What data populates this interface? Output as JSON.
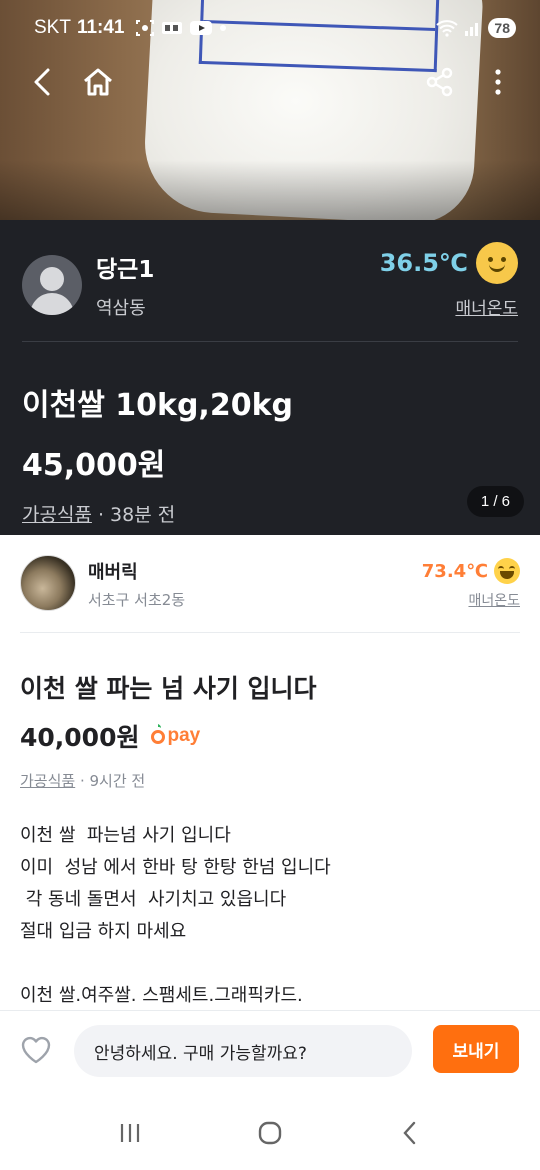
{
  "status_bar": {
    "carrier": "SKT",
    "time": "11:41",
    "battery": "78",
    "icons": [
      "screen-record-icon",
      "notification-icon",
      "youtube-icon",
      "dot-icon",
      "wifi-icon",
      "signal-icon"
    ]
  },
  "app_bar": {
    "icons": [
      "back-icon",
      "home-icon",
      "share-icon",
      "more-icon"
    ]
  },
  "screenshot_card": {
    "seller_name": "당근1",
    "seller_location": "역삼동",
    "manner_temp": "36.5℃",
    "manner_label": "매너온도",
    "title": "이천쌀 10kg,20kg",
    "price": "45,000원",
    "category": "가공식품",
    "meta_sep": " · ",
    "time_ago": "38분 전",
    "image_pager": "1 / 6"
  },
  "seller": {
    "name": "매버릭",
    "location": "서초구 서초2동",
    "manner_temp": "73.4℃",
    "manner_label": "매너온도"
  },
  "post": {
    "title": "이천 쌀 파는 넘 사기 입니다",
    "price": "40,000원",
    "pay_label": "pay",
    "category": "가공식품",
    "meta_sep": " · ",
    "time_ago": "9시간 전",
    "body": "이천 쌀  파는넘 사기 입니다\n이미  성남 에서 한바 탕 한탕 한넘 입니다\n 각 동네 돌면서  사기치고 있읍니다\n절대 입금 하지 마세요\n\n이천 쌀.여주쌀. 스팸세트.그래픽카드."
  },
  "bottom_bar": {
    "chat_value": "안녕하세요. 구매 가능할까요?",
    "send_label": "보내기"
  },
  "colors": {
    "accent": "#ff6f0f",
    "temp_orange": "#ff7e36",
    "temp_blue": "#7fd0e8",
    "dark_bg": "#1f2126"
  }
}
